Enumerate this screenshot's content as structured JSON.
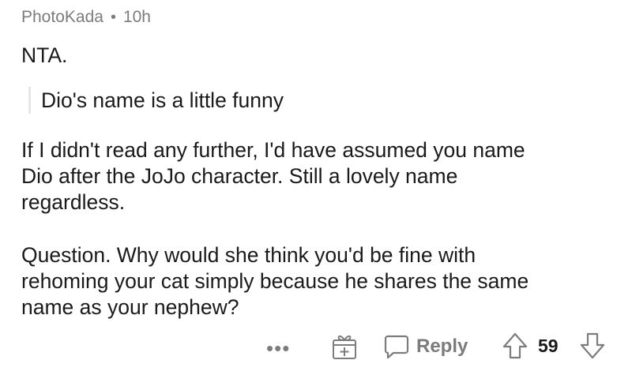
{
  "comment": {
    "author": "PhotoKada",
    "separator": "•",
    "age": "10h",
    "paragraphs": [
      "NTA.",
      "If I didn't read any further, I'd have assumed you name|Dio after the JoJo character. Still a lovely name|regardless.",
      "Question. Why would she think you'd be fine with|rehoming your cat simply because he shares the same|name as your nephew?"
    ],
    "quote": "Dio's name is a little funny"
  },
  "actions": {
    "more_label": "•••",
    "reply_label": "Reply",
    "score": "59",
    "icons": {
      "award": "gift-icon",
      "reply": "speech-bubble-icon",
      "upvote": "arrow-up-icon",
      "downvote": "arrow-down-icon"
    }
  },
  "colors": {
    "meta_text": "#7c7c7c",
    "body_text": "#1a1a1b",
    "quote_bar": "#e6e6e6",
    "icon": "#7c7c7c"
  }
}
